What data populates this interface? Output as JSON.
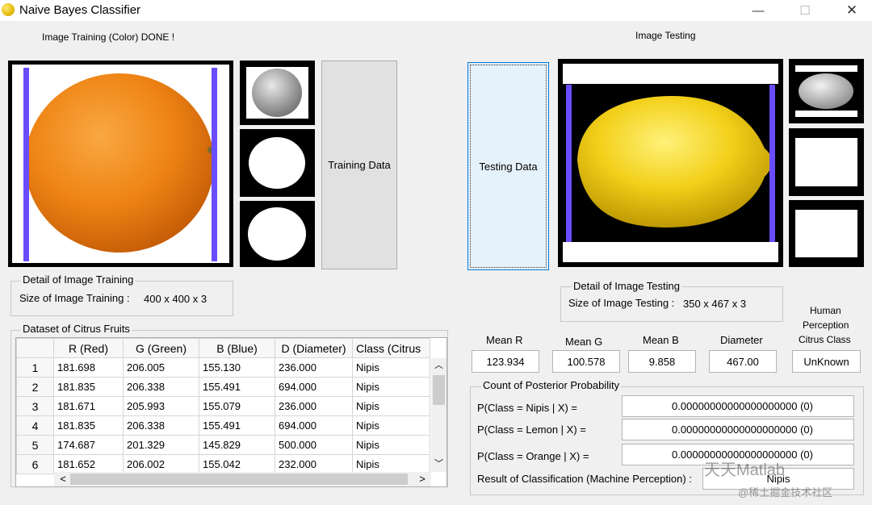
{
  "window": {
    "title": "Naive Bayes Classifier",
    "minimize_glyph": "—",
    "maximize_glyph": "☐",
    "close_glyph": "✕"
  },
  "training": {
    "status": "Image Training (Color) DONE !",
    "button_label": "Training Data",
    "detail_legend": "Detail of Image Training",
    "size_label": "Size of Image Training :",
    "size_value": "400 x 400 x 3"
  },
  "testing": {
    "header": "Image Testing",
    "button_label": "Testing Data",
    "detail_legend": "Detail of Image Testing",
    "size_label": "Size of Image Testing :",
    "size_value": "350 x 467 x 3"
  },
  "dataset": {
    "legend": "Dataset of Citrus Fruits",
    "columns": [
      "R (Red)",
      "G (Green)",
      "B (Blue)",
      "D (Diameter)",
      "Class (Citrus"
    ],
    "rows": [
      {
        "index": "1",
        "r": "181.698",
        "g": "206.005",
        "b": "155.130",
        "d": "236.000",
        "c": "Nipis"
      },
      {
        "index": "2",
        "r": "181.835",
        "g": "206.338",
        "b": "155.491",
        "d": "694.000",
        "c": "Nipis"
      },
      {
        "index": "3",
        "r": "181.671",
        "g": "205.993",
        "b": "155.079",
        "d": "236.000",
        "c": "Nipis"
      },
      {
        "index": "4",
        "r": "181.835",
        "g": "206.338",
        "b": "155.491",
        "d": "694.000",
        "c": "Nipis"
      },
      {
        "index": "5",
        "r": "174.687",
        "g": "201.329",
        "b": "145.829",
        "d": "500.000",
        "c": "Nipis"
      },
      {
        "index": "6",
        "r": "181.652",
        "g": "206.002",
        "b": "155.042",
        "d": "232.000",
        "c": "Nipis"
      }
    ],
    "scroll_up": "︿",
    "scroll_down": "﹀",
    "scroll_left": "<",
    "scroll_right": ">"
  },
  "features": {
    "mean_r_label": "Mean R",
    "mean_r_value": "123.934",
    "mean_g_label": "Mean G",
    "mean_g_value": "100.578",
    "mean_b_label": "Mean B",
    "mean_b_value": "9.858",
    "diameter_label": "Diameter",
    "diameter_value": "467.00",
    "human_label_1": "Human",
    "human_label_2": "Perception",
    "human_label_3": "Citrus Class",
    "human_value": "UnKnown"
  },
  "posterior": {
    "legend": "Count of  Posterior Probability",
    "nipis_label": "P(Class = Nipis | X) =",
    "nipis_value": "0.00000000000000000000  (0)",
    "lemon_label": "P(Class = Lemon | X) =",
    "lemon_value": "0.00000000000000000000  (0)",
    "orange_label": "P(Class = Orange | X) =",
    "orange_value": "0.00000000000000000000  (0)",
    "result_label": "Result of Classification (Machine Perception) :",
    "result_value": "Nipis"
  },
  "watermark": {
    "line1": "天天Matlab",
    "line2": "@稀土掘金技术社区"
  },
  "colors": {
    "orange_fruit": "#f08a1c",
    "lemon_fruit": "#f2d21b",
    "crop_line": "#6a4cff"
  }
}
